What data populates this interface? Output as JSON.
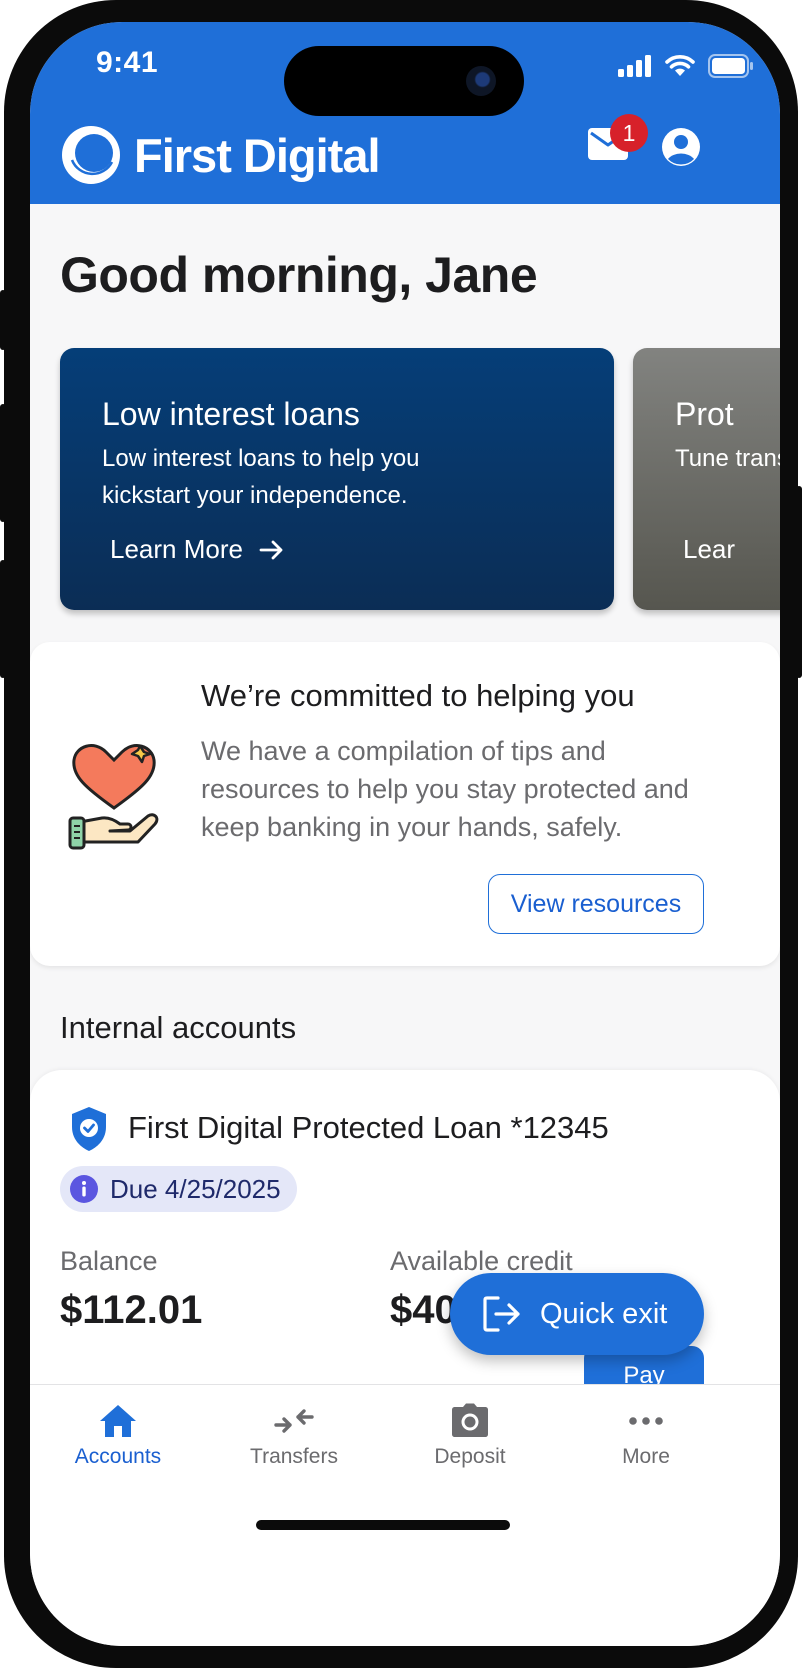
{
  "status_bar": {
    "time": "9:41"
  },
  "header": {
    "brand_name": "First Digital",
    "mail_badge_count": "1",
    "brand_color": "#1f6fd8"
  },
  "greeting": "Good morning, Jane",
  "promos": [
    {
      "title": "Low interest loans",
      "body": "Low interest loans to help you kickstart your independence.",
      "link_label": "Learn More"
    },
    {
      "title": "Prot",
      "body": "Tune transf",
      "link_label": "Lear"
    }
  ],
  "help_card": {
    "title": "We’re committed to helping you",
    "body": "We have a compilation of tips and resources to help you stay protected and keep banking in your hands, safely.",
    "button_label": "View resources"
  },
  "internal_accounts": {
    "section_title": "Internal accounts",
    "account": {
      "name": "First Digital Protected Loan *12345",
      "due_label": "Due 4/25/2025",
      "balance_label": "Balance",
      "balance_value": "$112.01",
      "credit_label": "Available credit",
      "credit_value": "$40",
      "pay_label": "Pay"
    }
  },
  "quick_exit": {
    "label": "Quick exit"
  },
  "bottom_nav": {
    "items": [
      {
        "label": "Accounts",
        "icon": "home-icon",
        "active": true
      },
      {
        "label": "Transfers",
        "icon": "transfer-arrows-icon",
        "active": false
      },
      {
        "label": "Deposit",
        "icon": "camera-icon",
        "active": false
      },
      {
        "label": "More",
        "icon": "more-dots-icon",
        "active": false
      }
    ]
  }
}
